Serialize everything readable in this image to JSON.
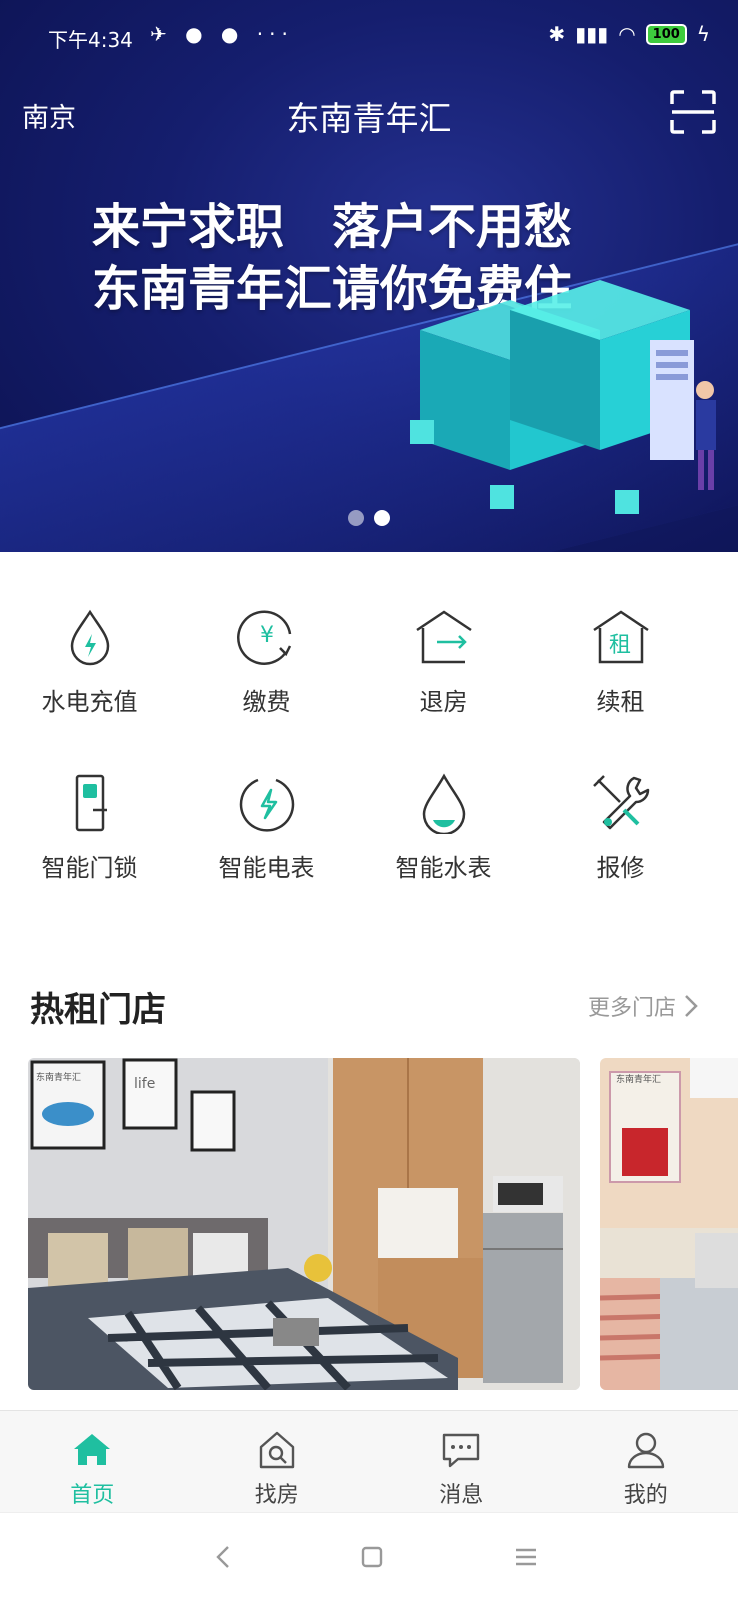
{
  "status_bar": {
    "time": "下午4:34",
    "battery": "100"
  },
  "header": {
    "city": "南京",
    "title": "东南青年汇"
  },
  "banner": {
    "line1": "来宁求职　落户不用愁",
    "line2": "东南青年汇请你免费住",
    "page_count": 2,
    "active_page": 2
  },
  "services": [
    {
      "label": "水电充值",
      "icon": "water-electricity-icon"
    },
    {
      "label": "缴费",
      "icon": "yuan-payment-icon"
    },
    {
      "label": "退房",
      "icon": "checkout-house-icon"
    },
    {
      "label": "续租",
      "icon": "renew-rent-icon"
    },
    {
      "label": "智能门锁",
      "icon": "smart-lock-icon"
    },
    {
      "label": "智能电表",
      "icon": "electric-meter-icon"
    },
    {
      "label": "智能水表",
      "icon": "water-meter-icon"
    },
    {
      "label": "报修",
      "icon": "repair-tools-icon"
    }
  ],
  "hot_stores": {
    "title": "热租门店",
    "more_label": "更多门店",
    "cards": [
      {
        "photo_sign": "东南青年汇",
        "poster": "life"
      },
      {
        "photo_sign": "东南青年汇"
      }
    ]
  },
  "tabs": [
    {
      "label": "首页",
      "icon": "home-icon",
      "active": true
    },
    {
      "label": "找房",
      "icon": "find-house-icon",
      "active": false
    },
    {
      "label": "消息",
      "icon": "message-icon",
      "active": false
    },
    {
      "label": "我的",
      "icon": "profile-icon",
      "active": false
    }
  ],
  "colors": {
    "accent": "#1fbfa0",
    "banner_bg": "#151e6e",
    "tab_bg": "#f7f7f7"
  }
}
